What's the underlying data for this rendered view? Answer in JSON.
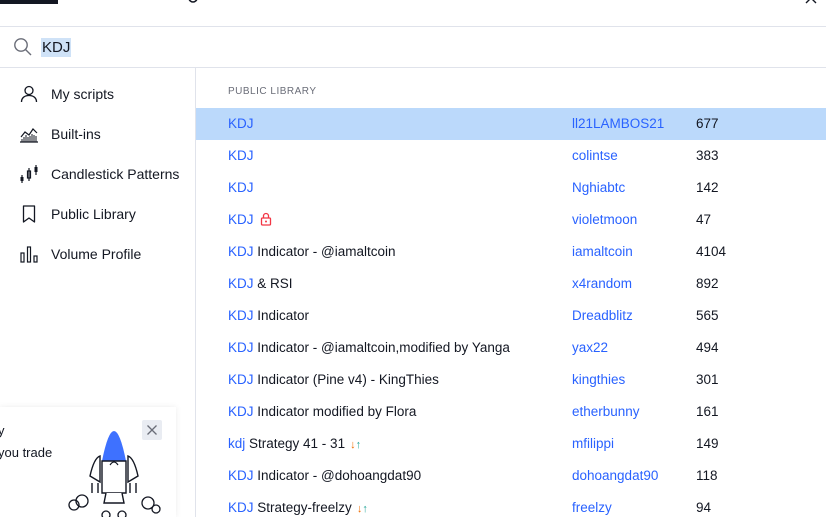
{
  "search": {
    "query": "KDJ"
  },
  "sidebar": {
    "items": [
      {
        "label": "My scripts",
        "icon": "user-icon"
      },
      {
        "label": "Built-ins",
        "icon": "chart-icon"
      },
      {
        "label": "Candlestick Patterns",
        "icon": "candlestick-icon"
      },
      {
        "label": "Public Library",
        "icon": "bookmark-icon"
      },
      {
        "label": "Volume Profile",
        "icon": "volume-profile-icon"
      }
    ]
  },
  "promo": {
    "line1": "y",
    "line2": "you trade"
  },
  "main": {
    "section_title": "PUBLIC LIBRARY",
    "rows": [
      {
        "hl": "KDJ",
        "rest": "",
        "author": "ll21LAMBOS21",
        "count": "677"
      },
      {
        "hl": "KDJ",
        "rest": "",
        "author": "colintse",
        "count": "383"
      },
      {
        "hl": "KDJ",
        "rest": "",
        "author": "Nghiabtc",
        "count": "142"
      },
      {
        "hl": "KDJ",
        "rest": "",
        "author": "violetmoon",
        "count": "47"
      },
      {
        "hl": "KDJ",
        "rest": " Indicator - @iamaltcoin",
        "author": "iamaltcoin",
        "count": "4104"
      },
      {
        "hl": "KDJ",
        "rest": " & RSI",
        "author": "x4random",
        "count": "892"
      },
      {
        "hl": "KDJ",
        "rest": " Indicator",
        "author": "Dreadblitz",
        "count": "565"
      },
      {
        "hl": "KDJ",
        "rest": " Indicator - @iamaltcoin,modified by Yanga",
        "author": "yax22",
        "count": "494"
      },
      {
        "hl": "KDJ",
        "rest": " Indicator (Pine v4) - KingThies",
        "author": "kingthies",
        "count": "301"
      },
      {
        "hl": "KDJ",
        "rest": " Indicator modified by Flora",
        "author": "etherbunny",
        "count": "161"
      },
      {
        "hl": "kdj",
        "rest": " Strategy 41 - 31",
        "author": "mfilippi",
        "count": "149"
      },
      {
        "hl": "KDJ",
        "rest": " Indicator - @dohoangdat90",
        "author": "dohoangdat90",
        "count": "118"
      },
      {
        "hl": "KDJ",
        "rest": " Strategy-freelzy",
        "author": "freelzy",
        "count": "94"
      }
    ]
  },
  "colors": {
    "accent": "#2962ff",
    "selected_row": "#bbd9fb",
    "lock": "#f23645"
  }
}
